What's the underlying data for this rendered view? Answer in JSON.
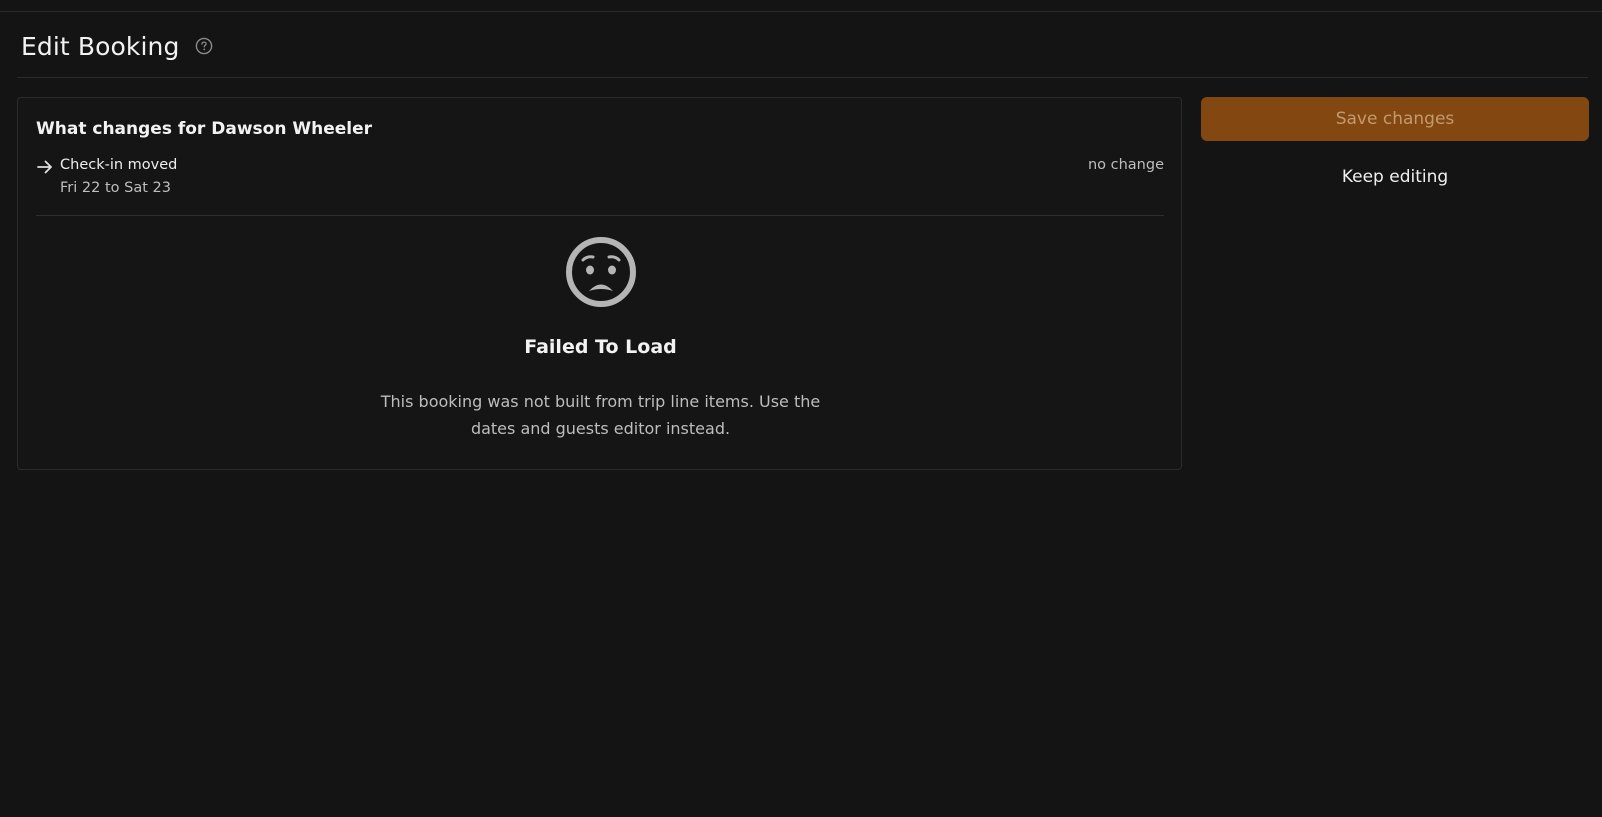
{
  "header": {
    "title": "Edit Booking",
    "help_icon": "help-circle-icon"
  },
  "changes_card": {
    "title": "What changes for Dawson Wheeler",
    "items": [
      {
        "icon": "arrow-right-icon",
        "label": "Check-in moved",
        "detail": "Fri 22 to Sat 23",
        "status": "no change"
      }
    ],
    "error": {
      "icon": "sad-face-icon",
      "title": "Failed To Load",
      "message": "This booking was not built from trip line items. Use the dates and guests editor instead."
    }
  },
  "actions": {
    "save_label": "Save changes",
    "keep_label": "Keep editing"
  },
  "colors": {
    "background": "#141414",
    "accent": "#834811",
    "accent_text": "#c29a6f"
  }
}
